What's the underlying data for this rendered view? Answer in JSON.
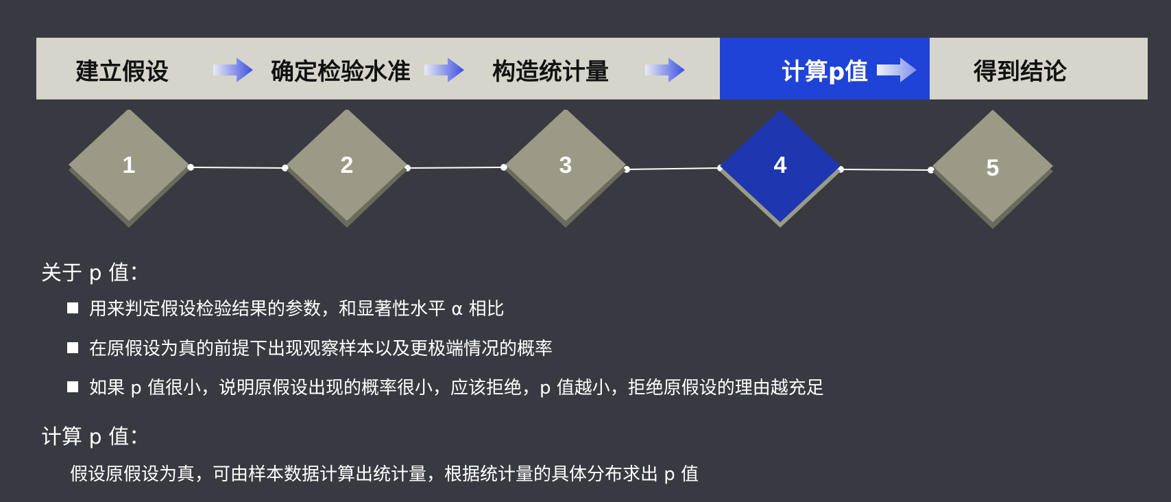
{
  "process": {
    "steps": [
      {
        "label": "建立假设",
        "active": false
      },
      {
        "label": "确定检验水准",
        "active": false
      },
      {
        "label": "构造统计量",
        "active": false
      },
      {
        "label": "计算p值",
        "active": true
      },
      {
        "label": "得到结论",
        "active": false
      }
    ]
  },
  "diamonds": {
    "numbers": [
      "1",
      "2",
      "3",
      "4",
      "5"
    ],
    "active_index": 3
  },
  "colors": {
    "background": "#393a41",
    "bar": "#d5d5cb",
    "active": "#1f43d7",
    "diamond": "#9a9a86",
    "diamond_active": "#1e36b0"
  },
  "about_p": {
    "title": "关于 p 值：",
    "bullets": [
      "用来判定假设检验结果的参数，和显著性水平 α 相比",
      "在原假设为真的前提下出现观察样本以及更极端情况的概率",
      "如果 p 值很小，说明原假设出现的概率很小，应该拒绝，p 值越小，拒绝原假设的理由越充足"
    ]
  },
  "calc_p": {
    "title": "计算 p 值：",
    "text": "假设原假设为真，可由样本数据计算出统计量，根据统计量的具体分布求出 p 值"
  }
}
